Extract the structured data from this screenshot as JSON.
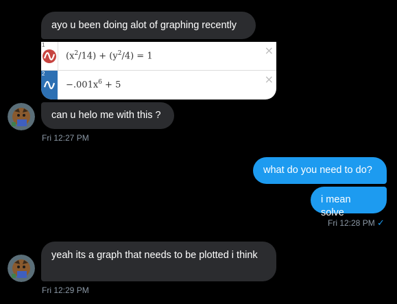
{
  "messages": {
    "m1": "ayo u been doing alot of graphing recently",
    "m2": "can u helo me with this ?",
    "m2_time": "Fri 12:27 PM",
    "m3": "what do you need to do?",
    "m4": "i mean solve",
    "m4_time": "Fri 12:28 PM",
    "m4_status": "✓",
    "m5": "yeah its a graph that needs to be plotted i think",
    "m5_time": "Fri 12:29 PM"
  },
  "desmos": {
    "rows": [
      {
        "num": "1",
        "expr_a": "(x",
        "exp1": "2",
        "expr_b": "/14) + (y",
        "exp2": "2",
        "expr_c": "/4) = 1",
        "color": "#c74440"
      },
      {
        "num": "2",
        "expr_a": "−.001x",
        "exp1": "6",
        "expr_b": " + 5",
        "color": "#2d70b3"
      }
    ],
    "close_glyph": "×"
  },
  "colors": {
    "background": "#000000",
    "incoming_bubble": "#2b2c2f",
    "outgoing_bubble": "#1d9bf0",
    "timestamp": "#8b98a5"
  }
}
